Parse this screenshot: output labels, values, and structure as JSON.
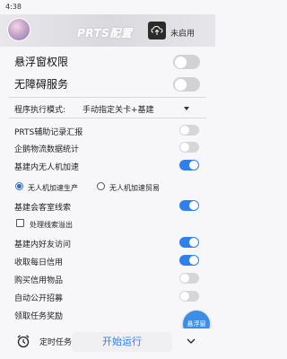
{
  "status_bar": {
    "time": "4:38"
  },
  "header": {
    "title": "PRTS配置",
    "update_label": "未启用"
  },
  "main_switches": [
    {
      "label": "悬浮窗权限",
      "on": false
    },
    {
      "label": "无障碍服务",
      "on": false
    }
  ],
  "mode": {
    "label": "程序执行模式:",
    "value": "手动指定关卡+基建"
  },
  "settings": [
    {
      "label": "PRTS辅助记录汇报",
      "on": false
    },
    {
      "label": "企鹅物流数据统计",
      "on": false
    },
    {
      "label": "基建内无人机加速",
      "on": true
    }
  ],
  "drone_options": [
    {
      "label": "无人机加速生产",
      "checked": true
    },
    {
      "label": "无人机加速贸易",
      "checked": false
    }
  ],
  "reception": {
    "label": "基建会客室线索",
    "on": true
  },
  "overflow_checkbox": {
    "label": "处理线索溢出",
    "checked": false
  },
  "settings2": [
    {
      "label": "基建内好友访问",
      "on": true
    },
    {
      "label": "收取每日信用",
      "on": true
    },
    {
      "label": "购买信用物品",
      "on": false
    },
    {
      "label": "自动公开招募",
      "on": false
    },
    {
      "label": "领取任务奖励",
      "on": false
    }
  ],
  "float_button": {
    "label": "悬浮窗"
  },
  "bottom": {
    "timer_label": "定时任务",
    "start_label": "开始运行"
  },
  "colors": {
    "accent": "#2f80ed",
    "toggle_off": "#d6d6d9"
  }
}
